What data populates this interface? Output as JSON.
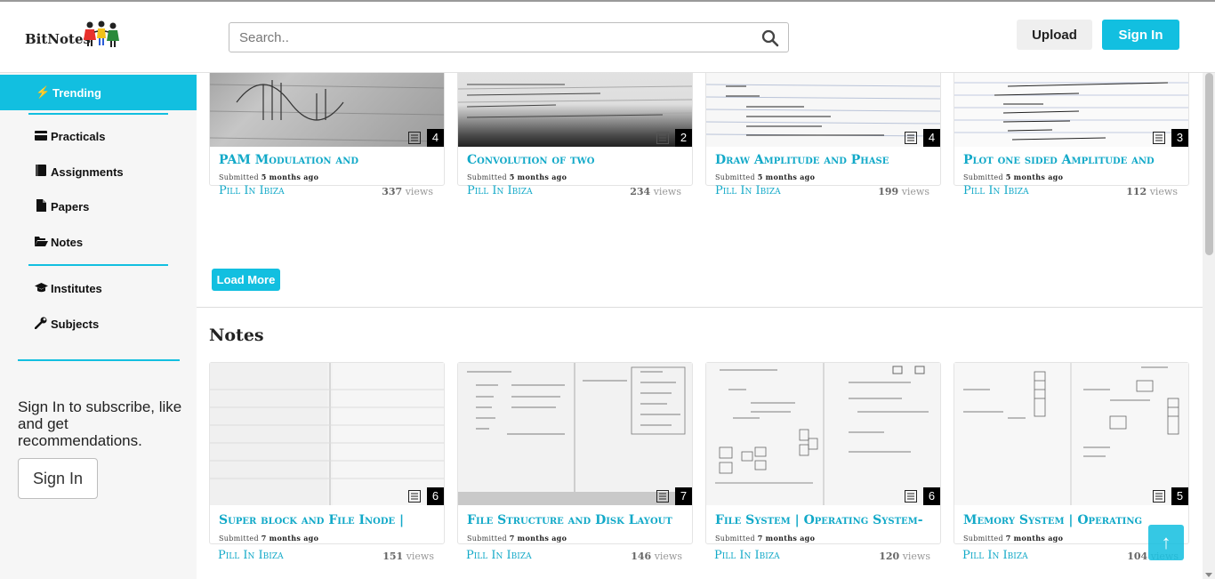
{
  "header": {
    "logo_text": "BitNotes",
    "search_placeholder": "Search..",
    "upload_label": "Upload",
    "signin_label": "Sign In"
  },
  "sidebar": {
    "items": [
      {
        "label": "Trending",
        "icon": "bolt-icon"
      },
      {
        "label": "Practicals",
        "icon": "card-icon"
      },
      {
        "label": "Assignments",
        "icon": "book-icon"
      },
      {
        "label": "Papers",
        "icon": "file-icon"
      },
      {
        "label": "Notes",
        "icon": "folder-open-icon"
      },
      {
        "label": "Institutes",
        "icon": "graduation-cap-icon"
      },
      {
        "label": "Subjects",
        "icon": "wrench-icon"
      }
    ],
    "message": "Sign In to subscribe, like and get recommendations.",
    "signin_label": "Sign In"
  },
  "trending": {
    "cards": [
      {
        "title": "PAM Modulation and",
        "submitted_prefix": "Submitted",
        "submitted_when": "5 months ago",
        "author": "Pill In Ibiza",
        "views": "337",
        "views_label": "views",
        "pages": "4"
      },
      {
        "title": "Convolution of two",
        "submitted_prefix": "Submitted",
        "submitted_when": "5 months ago",
        "author": "Pill In Ibiza",
        "views": "234",
        "views_label": "views",
        "pages": "2"
      },
      {
        "title": "Draw Amplitude and Phase",
        "submitted_prefix": "Submitted",
        "submitted_when": "5 months ago",
        "author": "Pill In Ibiza",
        "views": "199",
        "views_label": "views",
        "pages": "4"
      },
      {
        "title": "Plot one sided Amplitude and",
        "submitted_prefix": "Submitted",
        "submitted_when": "5 months ago",
        "author": "Pill In Ibiza",
        "views": "112",
        "views_label": "views",
        "pages": "3"
      }
    ],
    "load_more_label": "Load More"
  },
  "notes": {
    "section_title": "Notes",
    "cards": [
      {
        "title": "Super block and File Inode |",
        "submitted_prefix": "Submitted",
        "submitted_when": "7 months ago",
        "author": "Pill In Ibiza",
        "views": "151",
        "views_label": "views",
        "pages": "6"
      },
      {
        "title": "File Structure and Disk Layout",
        "submitted_prefix": "Submitted",
        "submitted_when": "7 months ago",
        "author": "Pill In Ibiza",
        "views": "146",
        "views_label": "views",
        "pages": "7"
      },
      {
        "title": "File System | Operating System-",
        "submitted_prefix": "Submitted",
        "submitted_when": "7 months ago",
        "author": "Pill In Ibiza",
        "views": "120",
        "views_label": "views",
        "pages": "6"
      },
      {
        "title": "Memory System | Operating",
        "submitted_prefix": "Submitted",
        "submitted_when": "7 months ago",
        "author": "Pill In Ibiza",
        "views": "104",
        "views_label": "views",
        "pages": "5"
      }
    ]
  },
  "back_to_top": "↑",
  "colors": {
    "accent": "#12bfe0",
    "link": "#12a9c8",
    "sidebar_bg": "#f6f6f6"
  }
}
